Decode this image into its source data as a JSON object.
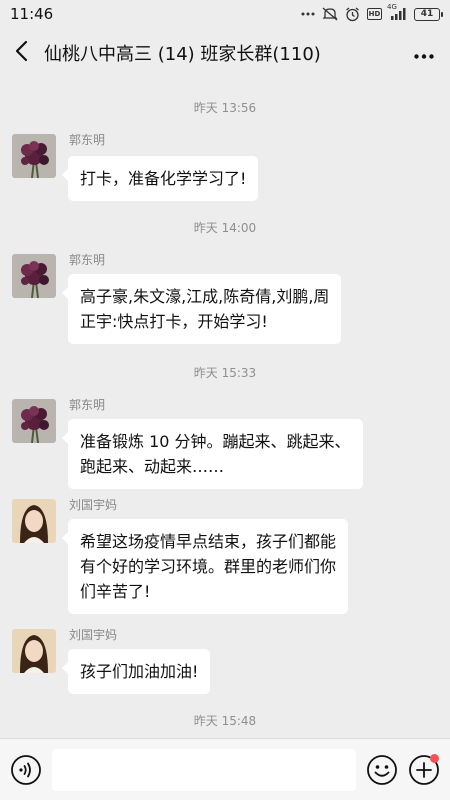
{
  "status_bar": {
    "time": "11:46",
    "network": "4G",
    "hd_label": "HD",
    "battery": "41",
    "icons": [
      "more-dots-icon",
      "mute-icon",
      "alarm-icon",
      "hd-icon",
      "signal-icon",
      "battery-icon"
    ]
  },
  "header": {
    "title": "仙桃八中高三 (14) 班家长群(110)",
    "back_icon": "chevron-left-icon",
    "more_icon": "more-dots-icon"
  },
  "chat": {
    "items": [
      {
        "type": "timestamp",
        "text": "昨天 13:56"
      },
      {
        "type": "message",
        "sender": "郭东明",
        "avatar": "flower-avatar",
        "lines": [
          "打卡，准备化学学习了!"
        ]
      },
      {
        "type": "timestamp",
        "text": "昨天 14:00"
      },
      {
        "type": "message",
        "sender": "郭东明",
        "avatar": "flower-avatar",
        "lines": [
          "高子豪,朱文濠,江成,陈奇倩,刘鹏,周",
          "正宇:快点打卡，开始学习!"
        ]
      },
      {
        "type": "timestamp",
        "text": "昨天 15:33"
      },
      {
        "type": "message",
        "sender": "郭东明",
        "avatar": "flower-avatar",
        "lines": [
          "准备锻炼 10 分钟。蹦起来、跳起来、",
          "跑起来、动起来……"
        ]
      },
      {
        "type": "message",
        "sender": "刘国宇妈",
        "avatar": "woman-avatar",
        "lines": [
          "希望这场疫情早点结束，孩子们都能",
          "有个好的学习环境。群里的老师们你",
          "们辛苦了!"
        ]
      },
      {
        "type": "message",
        "sender": "刘国宇妈",
        "avatar": "woman-avatar",
        "lines": [
          "孩子们加油加油!"
        ]
      },
      {
        "type": "timestamp",
        "text": "昨天 15:48"
      }
    ]
  },
  "input_bar": {
    "voice_icon": "voice-icon",
    "input_value": "",
    "emoji_icon": "emoji-icon",
    "plus_icon": "plus-icon"
  },
  "colors": {
    "background": "#ededed",
    "bubble": "#ffffff",
    "timestamp": "#8f8f8f",
    "notification_dot": "#f45454"
  }
}
